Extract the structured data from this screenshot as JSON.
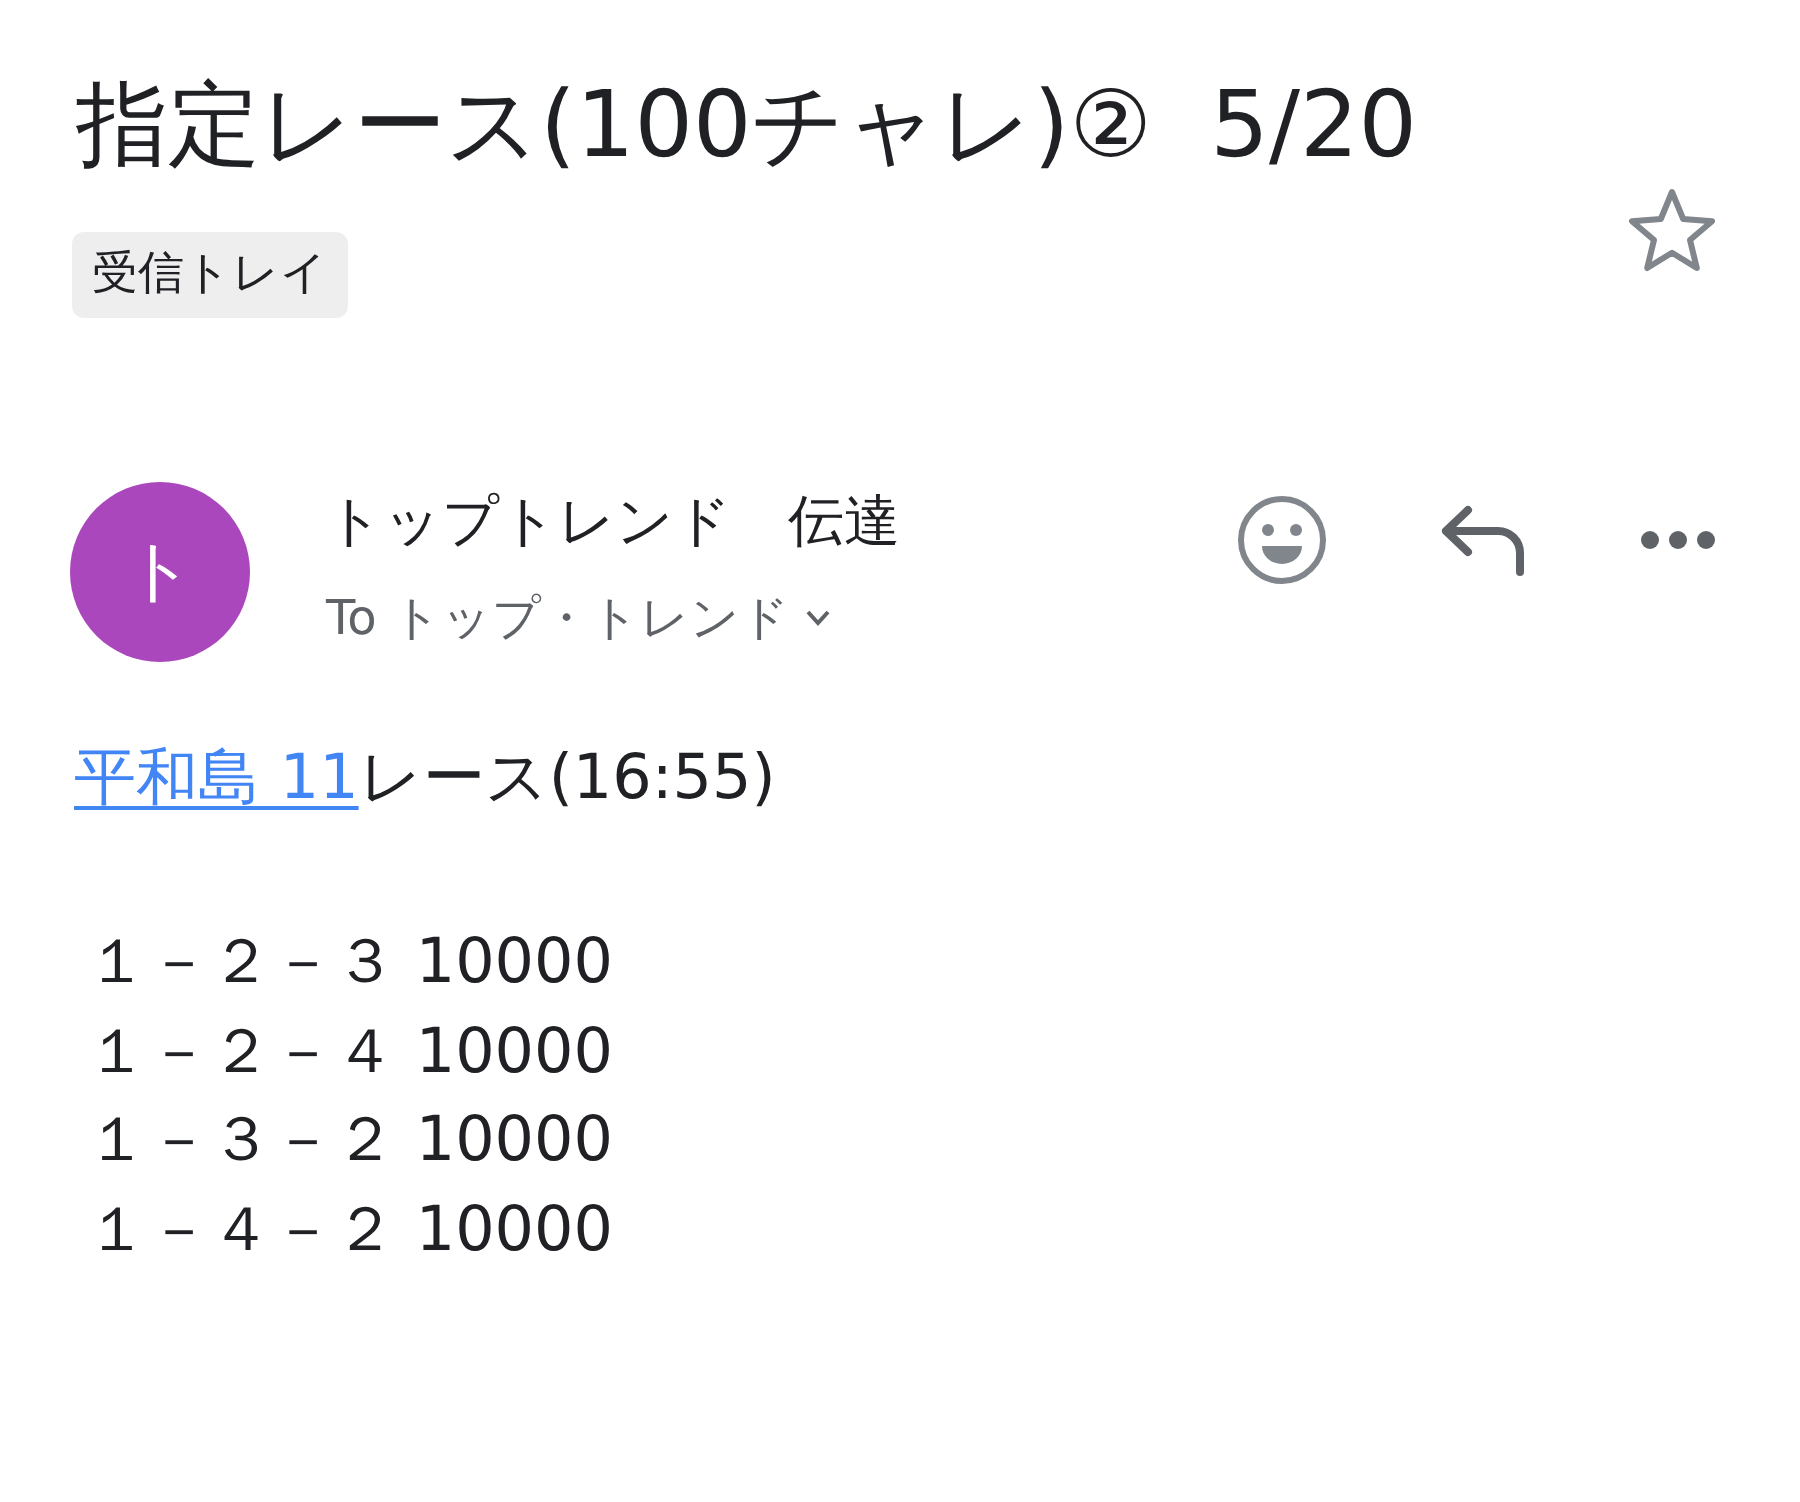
{
  "header": {
    "subject": "指定レース(100チャレ)②  5/20",
    "label": "受信トレイ",
    "starred": false
  },
  "message": {
    "avatar_initial": "ト",
    "sender": "トップトレンド　伝達",
    "recipients": "To トップ・トレンド"
  },
  "body": {
    "race_link": "平和島 11",
    "race_text": "レース(16:55)",
    "bets": [
      "１－２－３ 10000",
      "１－２－４ 10000",
      "１－３－２ 10000",
      "１－４－２ 10000"
    ]
  }
}
